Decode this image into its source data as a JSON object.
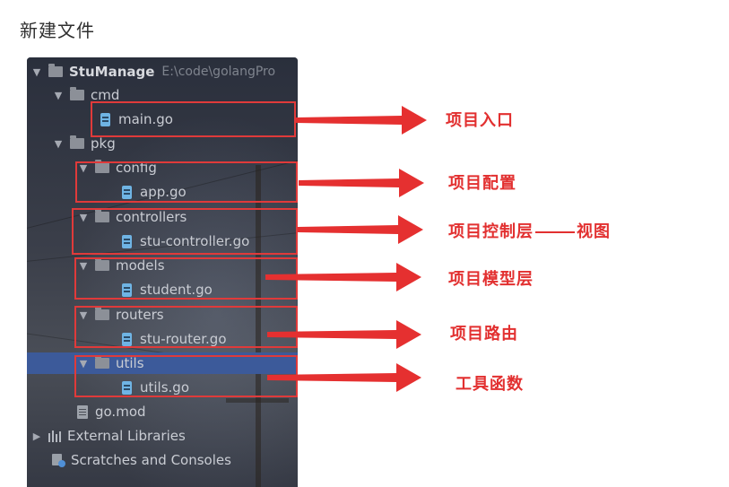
{
  "heading": "新建文件",
  "tree": {
    "project_name": "StuManage",
    "project_path": "E:\\code\\golangPro",
    "folders": {
      "cmd": "cmd",
      "pkg": "pkg",
      "config": "config",
      "controllers": "controllers",
      "models": "models",
      "routers": "routers",
      "utils": "utils"
    },
    "files": {
      "main": "main.go",
      "app": "app.go",
      "controller": "stu-controller.go",
      "student": "student.go",
      "router": "stu-router.go",
      "utils": "utils.go",
      "gomod": "go.mod"
    },
    "external_libraries": "External Libraries",
    "scratches": "Scratches and Consoles",
    "selected": "utils"
  },
  "annotations": {
    "entry": "项目入口",
    "config": "项目配置",
    "controller_prefix": "项目控制层",
    "controller_suffix": "视图",
    "model": "项目模型层",
    "router": "项目路由",
    "utils": "工具函数"
  },
  "colors": {
    "annotation_red": "#e23030",
    "panel_bg": "#2b2f3a",
    "selection": "#3c5a9a",
    "go_icon": "#6fb4e4"
  }
}
